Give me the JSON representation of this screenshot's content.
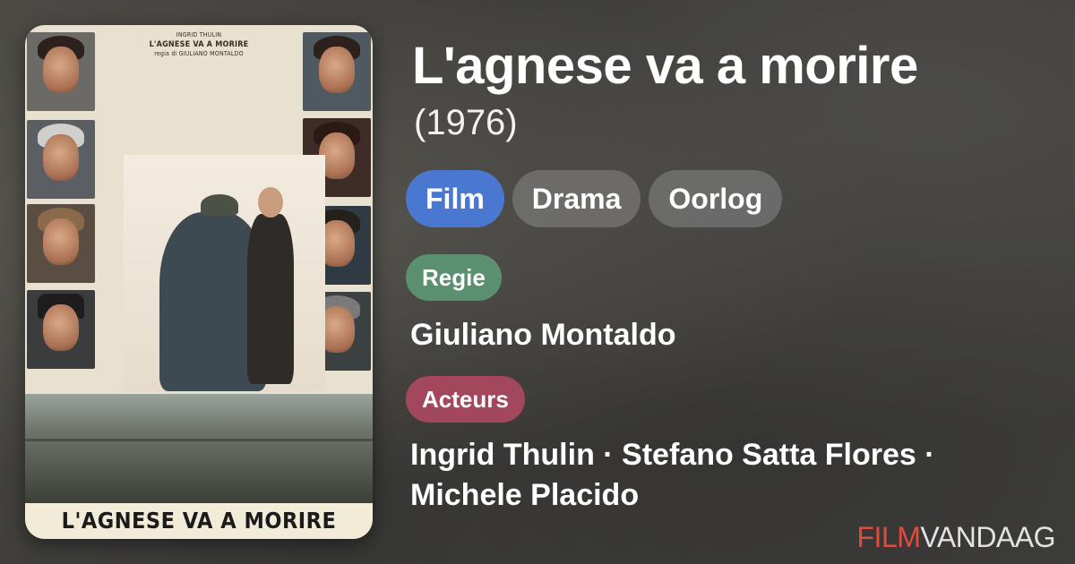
{
  "movie": {
    "title": "L'agnese va a morire",
    "year": "(1976)"
  },
  "genres": [
    "Film",
    "Drama",
    "Oorlog"
  ],
  "regie": {
    "label": "Regie",
    "value": "Giuliano Montaldo"
  },
  "acteurs": {
    "label": "Acteurs",
    "value": "Ingrid Thulin · Stefano Satta Flores · Michele Placido"
  },
  "poster": {
    "title": "L'AGNESE VA A MORIRE",
    "credits": [
      "INGRID THULIN",
      "L'AGNESE VA A MORIRE",
      "regia di GIULIANO MONTALDO"
    ]
  },
  "brand": {
    "part1": "FILM",
    "part2": "VANDAAG"
  },
  "colors": {
    "film_pill": "#4a78d1",
    "regie_label": "#5a8f6f",
    "acteurs_label": "#a3475e",
    "brand_red": "#e14b3f"
  }
}
